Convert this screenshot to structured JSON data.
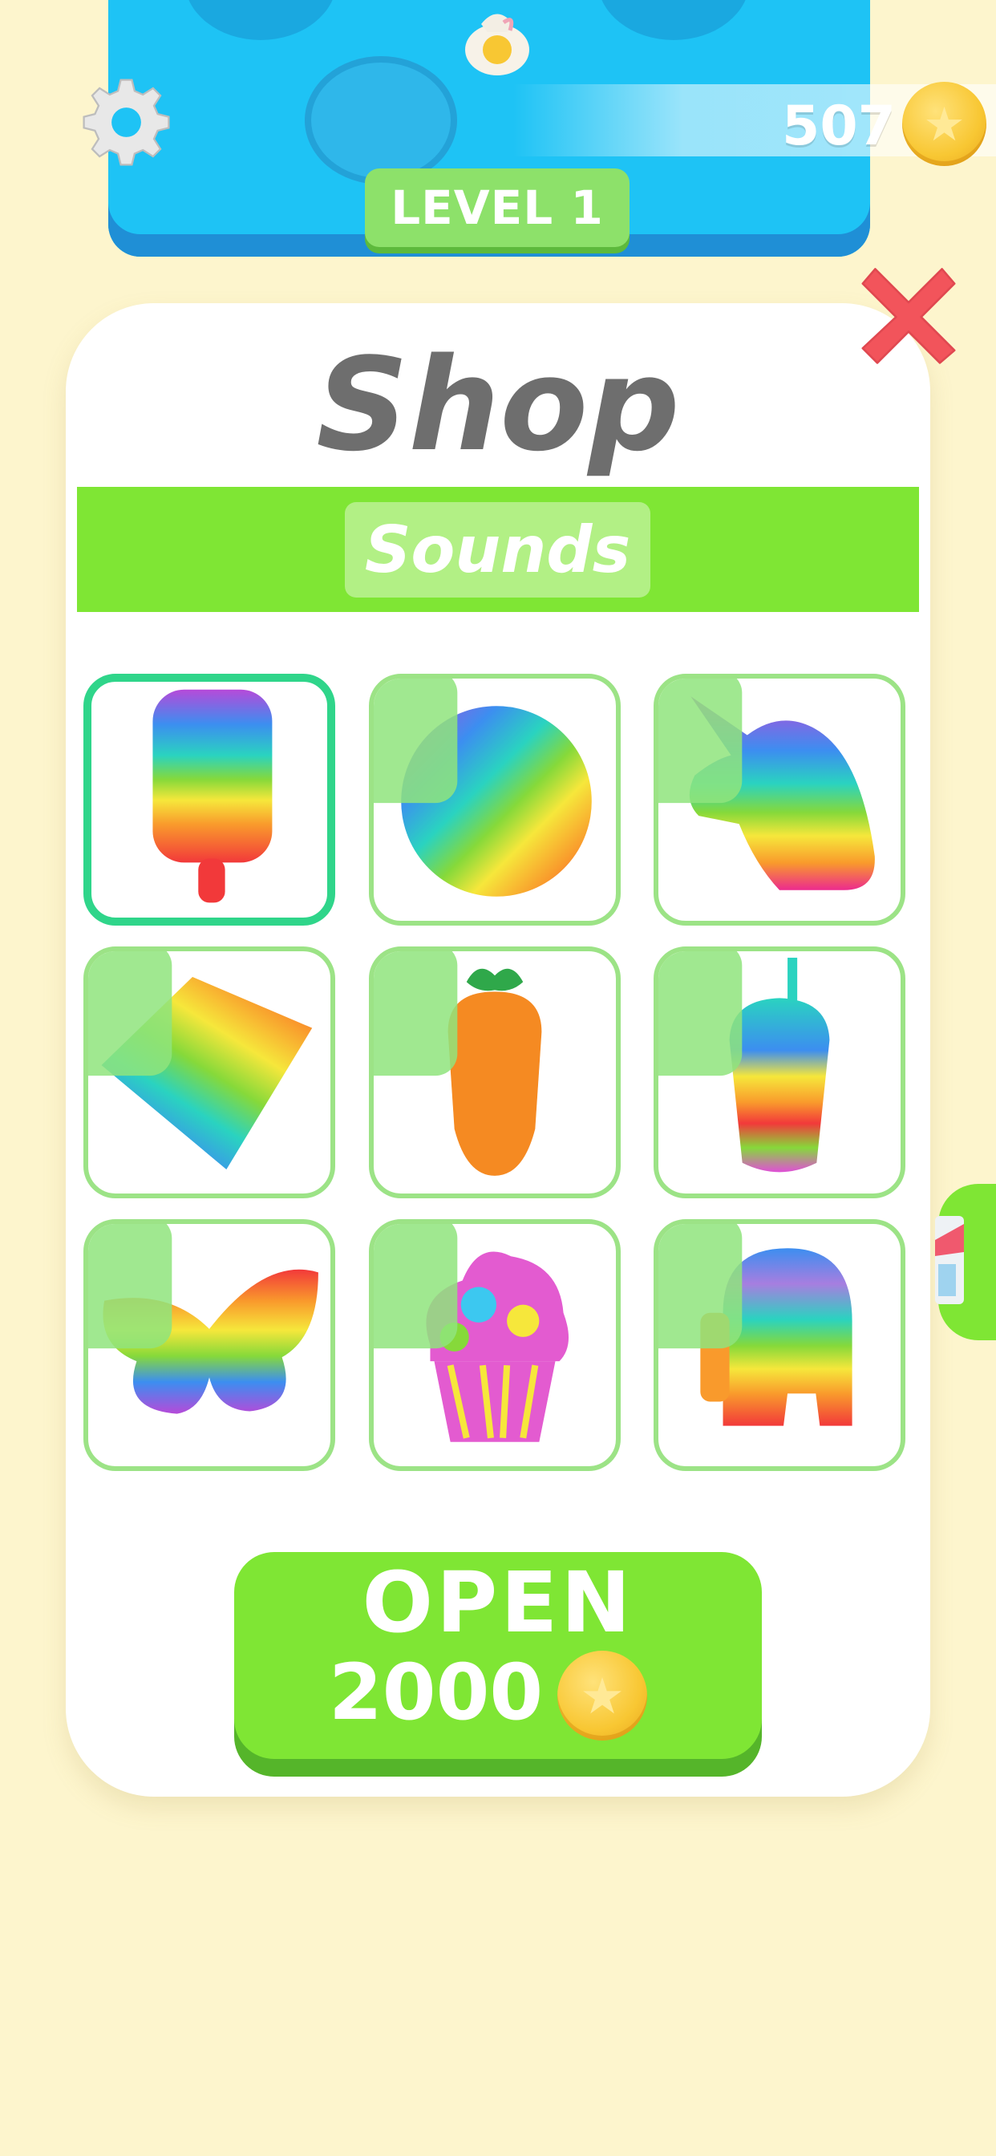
{
  "hud": {
    "level_label": "LEVEL 1",
    "coins": "507",
    "settings_icon": "gear-icon",
    "coin_icon": "star-coin-icon"
  },
  "shop": {
    "title": "Shop",
    "tab_label": "Sounds",
    "close_icon": "close-x-icon",
    "items": [
      {
        "name": "popsicle",
        "locked": false,
        "selected": true
      },
      {
        "name": "circle",
        "locked": true,
        "selected": false
      },
      {
        "name": "unicorn",
        "locked": true,
        "selected": false
      },
      {
        "name": "square",
        "locked": true,
        "selected": false
      },
      {
        "name": "carrot",
        "locked": true,
        "selected": false
      },
      {
        "name": "cup",
        "locked": true,
        "selected": false
      },
      {
        "name": "butterfly",
        "locked": true,
        "selected": false
      },
      {
        "name": "cupcake",
        "locked": true,
        "selected": false
      },
      {
        "name": "crewmate",
        "locked": true,
        "selected": false
      }
    ],
    "open_button": {
      "label": "OPEN",
      "price": "2000"
    }
  },
  "colors": {
    "background": "#fdf5cd",
    "accent_green": "#7fe634",
    "board_blue": "#1ec3f5",
    "close_red": "#f2545b",
    "selected_border": "#2fd58a"
  }
}
